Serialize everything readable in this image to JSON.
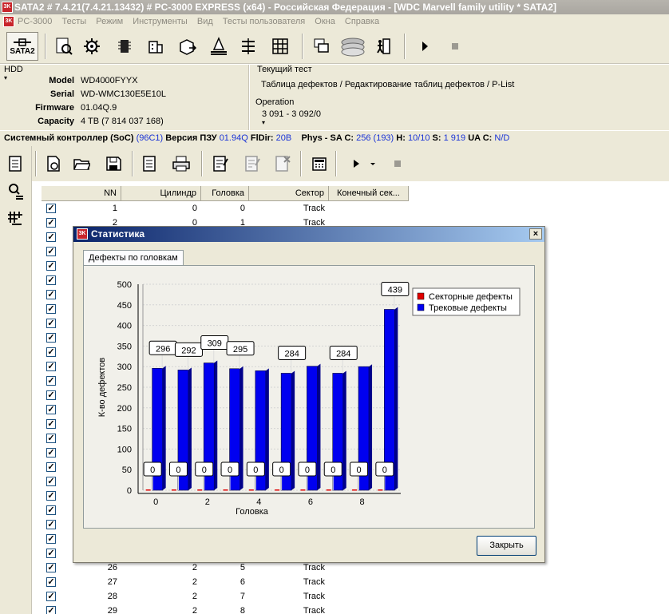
{
  "window": {
    "title": "SATA2 # 7.4.21(7.4.21.13432) # PC-3000 EXPRESS (x64) - Российская Федерация - [WDC Marvell family utility * SATA2]",
    "icon_text": "3K"
  },
  "menu": [
    "PC-3000",
    "Тесты",
    "Режим",
    "Инструменты",
    "Вид",
    "Тесты пользователя",
    "Окна",
    "Справка"
  ],
  "toolbar": {
    "sata_label": "SATA2"
  },
  "hdd": {
    "group_title": "HDD",
    "rows": [
      {
        "label": "Model",
        "value": "WD4000FYYX"
      },
      {
        "label": "Serial",
        "value": "WD-WMC130E5E10L"
      },
      {
        "label": "Firmware",
        "value": "01.04Q.9"
      },
      {
        "label": "Capacity",
        "value": "4 TB (7 814 037 168)"
      }
    ]
  },
  "current_test": {
    "group_title": "Текущий тест",
    "value": "Таблица дефектов / Редактирование таблиц дефектов / P-List"
  },
  "operation": {
    "group_title": "Operation",
    "value": "3 091 - 3 092/0"
  },
  "status": {
    "soc_label": "Системный контроллер (SoC)",
    "soc_value": "(96C1)",
    "rom_label": "Версия ПЗУ",
    "rom_value": "01.94Q",
    "fldir_label": "FlDir:",
    "fldir_value": "20B",
    "phys_label": "Phys - SA C:",
    "phys_value": "256 (193)",
    "h_label": "H:",
    "h_value": "10/10",
    "s_label": "S:",
    "s_value": "1 919",
    "uac_label": "UA C:",
    "uac_value": "N/D"
  },
  "table": {
    "headers": [
      "NN",
      "Цилиндр",
      "Головка",
      "Сектор",
      "Конечный сек..."
    ],
    "rows": [
      {
        "nn": "1",
        "cyl": "0",
        "head": "0",
        "sector": "Track"
      },
      {
        "nn": "2",
        "cyl": "0",
        "head": "1",
        "sector": "Track"
      },
      {
        "nn": "26",
        "cyl": "2",
        "head": "5",
        "sector": "Track"
      },
      {
        "nn": "27",
        "cyl": "2",
        "head": "6",
        "sector": "Track"
      },
      {
        "nn": "28",
        "cyl": "2",
        "head": "7",
        "sector": "Track"
      },
      {
        "nn": "29",
        "cyl": "2",
        "head": "8",
        "sector": "Track"
      }
    ],
    "check_mark": "✓"
  },
  "dialog": {
    "title": "Статистика",
    "tab_label": "Дефекты по головкам",
    "close_button": "Закрыть",
    "close_x": "×"
  },
  "chart_data": {
    "type": "bar",
    "categories": [
      "0",
      "1",
      "2",
      "3",
      "4",
      "5",
      "6",
      "7",
      "8",
      "9"
    ],
    "x_tick_labels": [
      "0",
      "2",
      "4",
      "6",
      "8"
    ],
    "xlabel": "Головка",
    "ylabel": "К-во дефектов",
    "ylim": [
      0,
      500
    ],
    "y_ticks": [
      "0",
      "50",
      "100",
      "150",
      "200",
      "250",
      "300",
      "350",
      "400",
      "450",
      "500"
    ],
    "legend_position": "top-right",
    "grid": true,
    "series": [
      {
        "name": "Секторные дефекты",
        "color": "#e00000",
        "values": [
          0,
          0,
          0,
          0,
          0,
          0,
          0,
          0,
          0,
          0
        ],
        "labels": [
          "0",
          "0",
          "0",
          "0",
          "0",
          "0",
          "0",
          "0",
          "0",
          "0"
        ]
      },
      {
        "name": "Трековые дефекты",
        "color": "#0000f0",
        "values": [
          296,
          292,
          309,
          295,
          290,
          284,
          301,
          284,
          300,
          439
        ],
        "labels": [
          "296",
          "292",
          "309",
          "295",
          "",
          "284",
          "",
          "284",
          "",
          "439"
        ]
      }
    ]
  }
}
